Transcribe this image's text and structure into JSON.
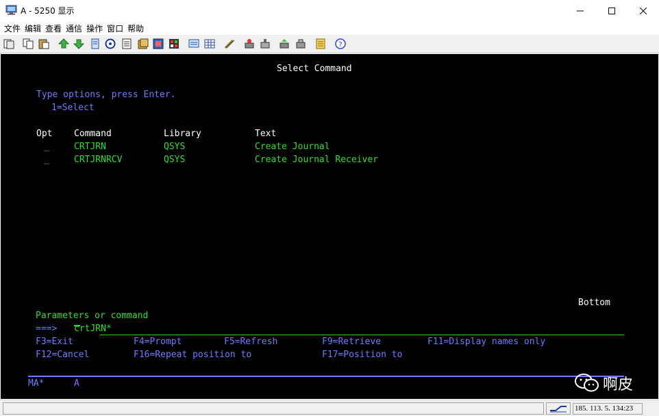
{
  "window": {
    "title": "A - 5250 显示",
    "icon": "monitor-icon"
  },
  "menu": [
    "文件",
    "编辑",
    "查看",
    "通信",
    "操作",
    "窗口",
    "帮助"
  ],
  "toolbar_icons": [
    "copy-screen-icon",
    "copy-icon",
    "paste-icon",
    "send-file-icon",
    "receive-file-icon",
    "print-icon",
    "record-icon",
    "macro-icon",
    "keypad-icon",
    "color-icon",
    "display-icon",
    "grid-icon",
    "pencil-icon",
    "disconnect-icon",
    "connect-icon",
    "notes-icon",
    "help-icon"
  ],
  "terminal": {
    "title": "Select Command",
    "instructions": "Type options, press Enter.",
    "option_1": "1=Select",
    "headers": {
      "opt": "Opt",
      "command": "Command",
      "library": "Library",
      "text": "Text"
    },
    "rows": [
      {
        "opt": "_",
        "command": "CRTJRN",
        "library": "QSYS",
        "text": "Create Journal"
      },
      {
        "opt": "_",
        "command": "CRTJRNRCV",
        "library": "QSYS",
        "text": "Create Journal Receiver"
      }
    ],
    "bottom": "Bottom",
    "params_label": "Parameters or command",
    "prompt": "===>",
    "command_input": "crtJRN*",
    "fkeys_row1": [
      "F3=Exit",
      "F4=Prompt",
      "F5=Refresh",
      "F9=Retrieve",
      "F11=Display names only"
    ],
    "fkeys_row2": [
      "F12=Cancel",
      "F16=Repeat position to",
      "F17=Position to"
    ],
    "status_left": "MA*",
    "status_session": "A"
  },
  "statusbar": {
    "ip": "185. 113. 5. 134:23"
  },
  "watermark": {
    "text": "啊皮"
  }
}
